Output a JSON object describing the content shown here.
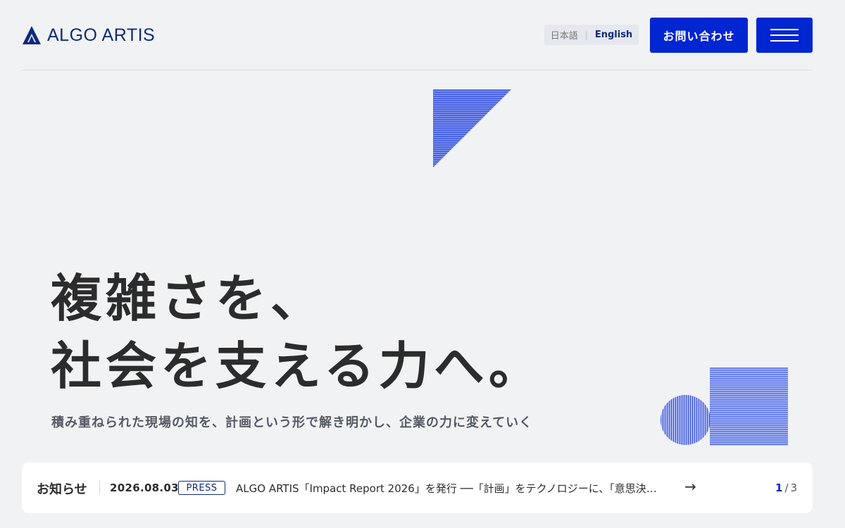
{
  "brand": {
    "name": "ALGO ARTIS",
    "color": "#0f2a7a"
  },
  "header": {
    "lang_ja": "日本語",
    "lang_en": "English",
    "contact_label": "お問い合わせ",
    "menu_icon": "hamburger-icon",
    "accent": "#0026d1"
  },
  "hero": {
    "line1": "複雑さを、",
    "line2": "社会を支える力へ。",
    "subcopy": "積み重ねられた現場の知を、計画という形で解き明かし、企業の力に変えていく"
  },
  "news": {
    "title": "お知らせ",
    "date": "2026.08.03",
    "tag": "PRESS",
    "headline": "ALGO ARTIS「Impact Report 2026」を発行 ──「計画」をテクノロジーに、「意思決…",
    "arrow_icon": "arrow-right-icon",
    "page_current": "1",
    "page_sep": "/",
    "page_total": "3"
  }
}
